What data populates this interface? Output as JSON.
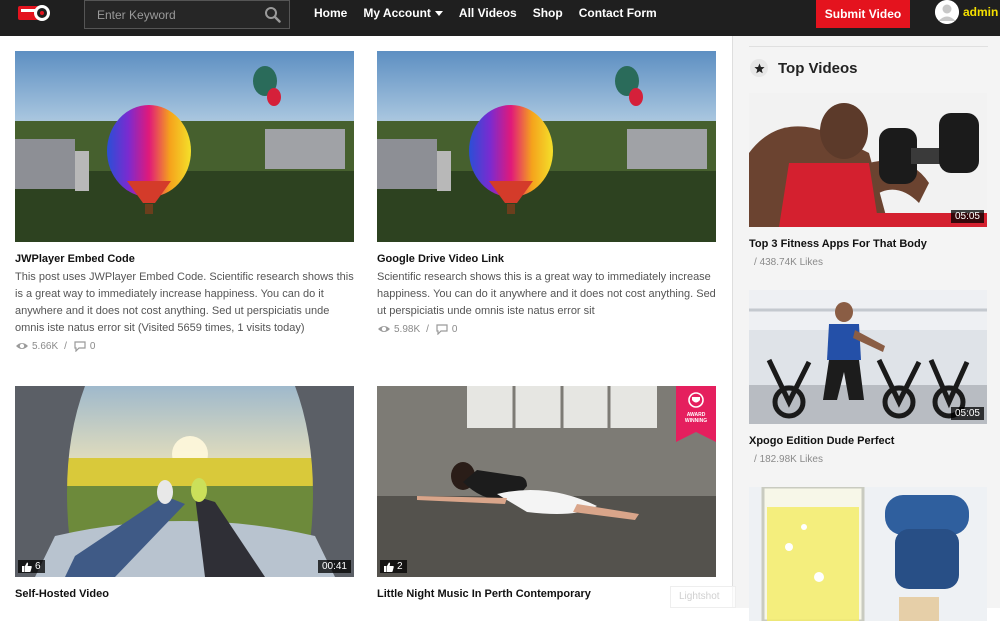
{
  "header": {
    "logo_icon": "video-camera-logo-icon",
    "search": {
      "placeholder": "Enter Keyword",
      "value": ""
    },
    "nav": [
      {
        "label": "Home"
      },
      {
        "label": "My Account",
        "has_dropdown": true
      },
      {
        "label": "All Videos"
      },
      {
        "label": "Shop"
      },
      {
        "label": "Contact Form"
      }
    ],
    "submit_label": "Submit Video",
    "user_name": "admin"
  },
  "colors": {
    "header_bg": "#1f1f1f",
    "submit_bg": "#e4131e",
    "user_name": "#f5e000",
    "award_badge": "#e51f5e"
  },
  "posts": [
    {
      "title": "JWPlayer Embed Code",
      "excerpt": "This post uses JWPlayer Embed Code. Scientific research shows this is a great way to immediately increase happiness. You can do it anywhere and it does not cost anything. Sed ut perspiciatis unde omnis iste natus error sit (Visited 5659 times, 1 visits today)",
      "views": "5.66K",
      "comments": "0"
    },
    {
      "title": "Google Drive Video Link",
      "excerpt": "Scientific research shows this is a great way to immediately increase happiness. You can do it anywhere and it does not cost anything. Sed ut perspiciatis unde omnis iste natus error sit",
      "views": "5.98K",
      "comments": "0"
    },
    {
      "title": "Self-Hosted Video",
      "likes": "6",
      "duration": "00:41"
    },
    {
      "title": "Little Night Music In Perth Contemporary",
      "likes": "2",
      "award": "AWARD WINNING"
    }
  ],
  "sidebar": {
    "widget_title": "Top Videos",
    "items": [
      {
        "title": "Top 3 Fitness Apps For That Body",
        "likes": "438.74K Likes",
        "duration": "05:05"
      },
      {
        "title": "Xpogo Edition Dude Perfect",
        "likes": "182.98K Likes",
        "duration": "05:05"
      },
      {
        "title": ""
      }
    ]
  },
  "overlay": {
    "watermark": "Lightshot"
  }
}
